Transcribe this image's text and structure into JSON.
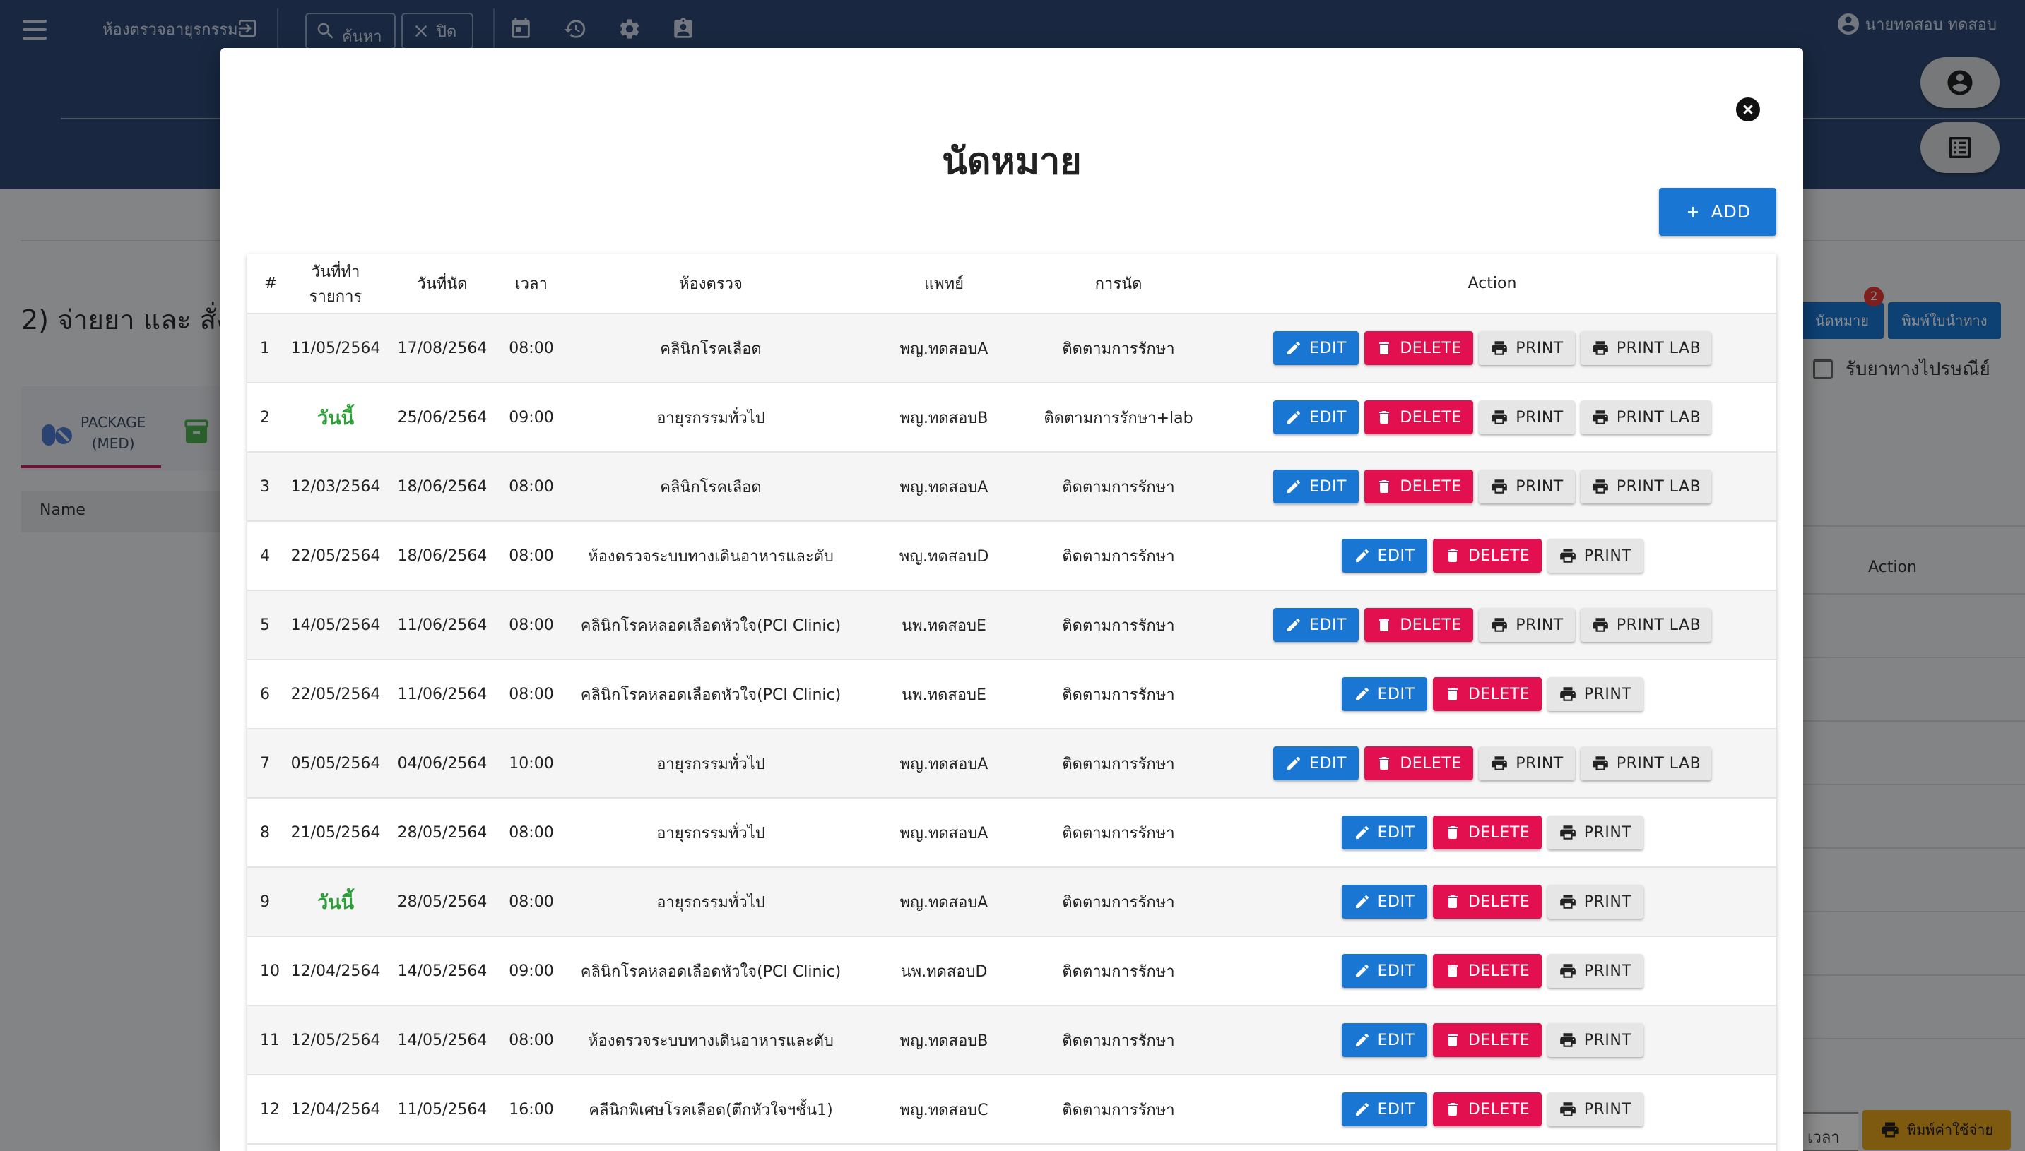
{
  "app": {
    "room_title": "ห้องตรวจอายุรกรรม",
    "search_label": "ค้นหา",
    "close_label": "ปิด",
    "user_name": "นายทดสอบ ทดสอบ"
  },
  "background": {
    "section_title": "2) จ่ายยา และ สั่ง",
    "tab_package_line1": "PACKAGE",
    "tab_package_line2": "(MED)",
    "name_header": "Name",
    "action_header": "Action",
    "appointment_button": "นัดหมาย",
    "appointment_badge": "2",
    "print_route_button": "พิมพ์ใบนำทาง",
    "mail_checkbox_label": "รับยาทางไปรษณีย์",
    "print_cost_button": "พิมพ์ค่าใช้จ่าย",
    "partial_text": "เวลา"
  },
  "modal": {
    "title": "นัดหมาย",
    "add_label": "ADD",
    "columns": [
      "#",
      "วันที่ทำรายการ",
      "วันที่นัด",
      "เวลา",
      "ห้องตรวจ",
      "แพทย์",
      "การนัด",
      "Action"
    ],
    "button_labels": {
      "edit": "EDIT",
      "delete": "DELETE",
      "print": "PRINT",
      "print_lab": "PRINT LAB"
    },
    "rows": [
      {
        "no": "1",
        "created": "11/05/2564",
        "date": "17/08/2564",
        "time": "08:00",
        "room": "คลินิกโรคเลือด",
        "doctor": "พญ.ทดสอบA",
        "type": "ติดตามการรักษา",
        "lab": true,
        "today": false
      },
      {
        "no": "2",
        "created": "วันนี้",
        "date": "25/06/2564",
        "time": "09:00",
        "room": "อายุรกรรมทั่วไป",
        "doctor": "พญ.ทดสอบB",
        "type": "ติดตามการรักษา+lab",
        "lab": true,
        "today": true
      },
      {
        "no": "3",
        "created": "12/03/2564",
        "date": "18/06/2564",
        "time": "08:00",
        "room": "คลินิกโรคเลือด",
        "doctor": "พญ.ทดสอบA",
        "type": "ติดตามการรักษา",
        "lab": true,
        "today": false
      },
      {
        "no": "4",
        "created": "22/05/2564",
        "date": "18/06/2564",
        "time": "08:00",
        "room": "ห้องตรวจระบบทางเดินอาหารและตับ",
        "doctor": "พญ.ทดสอบD",
        "type": "ติดตามการรักษา",
        "lab": false,
        "today": false
      },
      {
        "no": "5",
        "created": "14/05/2564",
        "date": "11/06/2564",
        "time": "08:00",
        "room": "คลินิกโรคหลอดเลือดหัวใจ(PCI Clinic)",
        "doctor": "นพ.ทดสอบE",
        "type": "ติดตามการรักษา",
        "lab": true,
        "today": false
      },
      {
        "no": "6",
        "created": "22/05/2564",
        "date": "11/06/2564",
        "time": "08:00",
        "room": "คลินิกโรคหลอดเลือดหัวใจ(PCI Clinic)",
        "doctor": "นพ.ทดสอบE",
        "type": "ติดตามการรักษา",
        "lab": false,
        "today": false
      },
      {
        "no": "7",
        "created": "05/05/2564",
        "date": "04/06/2564",
        "time": "10:00",
        "room": "อายุรกรรมทั่วไป",
        "doctor": "พญ.ทดสอบA",
        "type": "ติดตามการรักษา",
        "lab": true,
        "today": false
      },
      {
        "no": "8",
        "created": "21/05/2564",
        "date": "28/05/2564",
        "time": "08:00",
        "room": "อายุรกรรมทั่วไป",
        "doctor": "พญ.ทดสอบA",
        "type": "ติดตามการรักษา",
        "lab": false,
        "today": false
      },
      {
        "no": "9",
        "created": "วันนี้",
        "date": "28/05/2564",
        "time": "08:00",
        "room": "อายุรกรรมทั่วไป",
        "doctor": "พญ.ทดสอบA",
        "type": "ติดตามการรักษา",
        "lab": false,
        "today": true
      },
      {
        "no": "10",
        "created": "12/04/2564",
        "date": "14/05/2564",
        "time": "09:00",
        "room": "คลินิกโรคหลอดเลือดหัวใจ(PCI Clinic)",
        "doctor": "นพ.ทดสอบD",
        "type": "ติดตามการรักษา",
        "lab": false,
        "today": false
      },
      {
        "no": "11",
        "created": "12/05/2564",
        "date": "14/05/2564",
        "time": "08:00",
        "room": "ห้องตรวจระบบทางเดินอาหารและตับ",
        "doctor": "พญ.ทดสอบB",
        "type": "ติดตามการรักษา",
        "lab": false,
        "today": false
      },
      {
        "no": "12",
        "created": "12/04/2564",
        "date": "11/05/2564",
        "time": "16:00",
        "room": "คลีนิกพิเศษโรคเลือด(ตึกหัวใจฯชั้น1)",
        "doctor": "พญ.ทดสอบC",
        "type": "ติดตามการรักษา",
        "lab": false,
        "today": false
      }
    ]
  },
  "colors": {
    "topbar": "#2f4a75",
    "primary": "#1976d2",
    "delete": "#e3104f",
    "today_text": "#2e9d3a",
    "print_cost": "#e6a420"
  },
  "icons": [
    "menu-icon",
    "exit-icon",
    "search-icon",
    "close-x-icon",
    "calendar-icon",
    "history-icon",
    "gear-icon",
    "contact-card-icon",
    "account-circle-icon",
    "list-alt-icon",
    "close-circle-icon",
    "plus-icon",
    "pencil-icon",
    "trash-icon",
    "printer-icon"
  ]
}
